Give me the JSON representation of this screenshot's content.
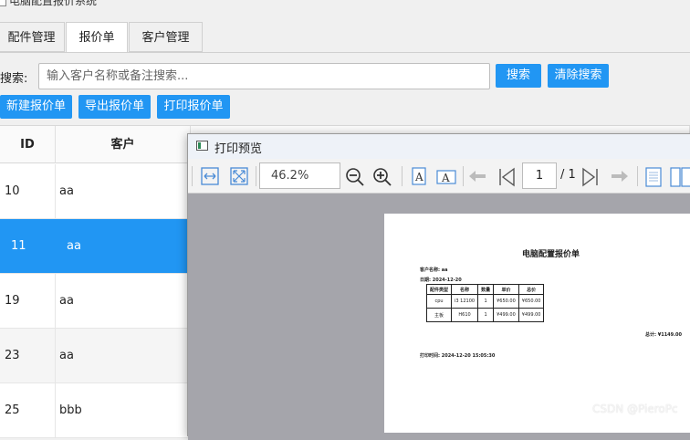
{
  "app": {
    "title": "电脑配置报价系统"
  },
  "tabs": [
    {
      "label": "配件管理"
    },
    {
      "label": "报价单"
    },
    {
      "label": "客户管理"
    }
  ],
  "search": {
    "label": "搜索:",
    "placeholder": "输入客户名称或备注搜索...",
    "value": "",
    "search_button": "搜索",
    "clear_button": "清除搜索"
  },
  "actions": {
    "new": "新建报价单",
    "export": "导出报价单",
    "print": "打印报价单"
  },
  "table": {
    "columns": [
      "ID",
      "客户"
    ],
    "rows": [
      {
        "id": "10",
        "customer": "aa"
      },
      {
        "id": "11",
        "customer": "aa",
        "selected": true
      },
      {
        "id": "19",
        "customer": "aa"
      },
      {
        "id": "23",
        "customer": "aa"
      },
      {
        "id": "25",
        "customer": "bbb"
      }
    ]
  },
  "preview": {
    "title": "打印预览",
    "zoom": "46.2%",
    "page_current": "1",
    "page_total": "/ 1",
    "document": {
      "heading": "电脑配置报价单",
      "customer_line": "客户名称: aa",
      "date_line": "日期: 2024-12-20",
      "columns": [
        "配件类型",
        "名称",
        "数量",
        "单价",
        "总价"
      ],
      "rows": [
        [
          "cpu",
          "i3 12100",
          "1",
          "¥650.00",
          "¥650.00"
        ],
        [
          "主板",
          "H610",
          "1",
          "¥499.00",
          "¥499.00"
        ]
      ],
      "total_line": "总计: ¥1149.00",
      "print_time": "打印时间: 2024-12-20 15:05:30"
    }
  },
  "watermark": "CSDN @PieroPc",
  "colors": {
    "accent": "#2196f3",
    "selected_row": "#2196f3",
    "canvas_gray": "#a5a5ab"
  }
}
